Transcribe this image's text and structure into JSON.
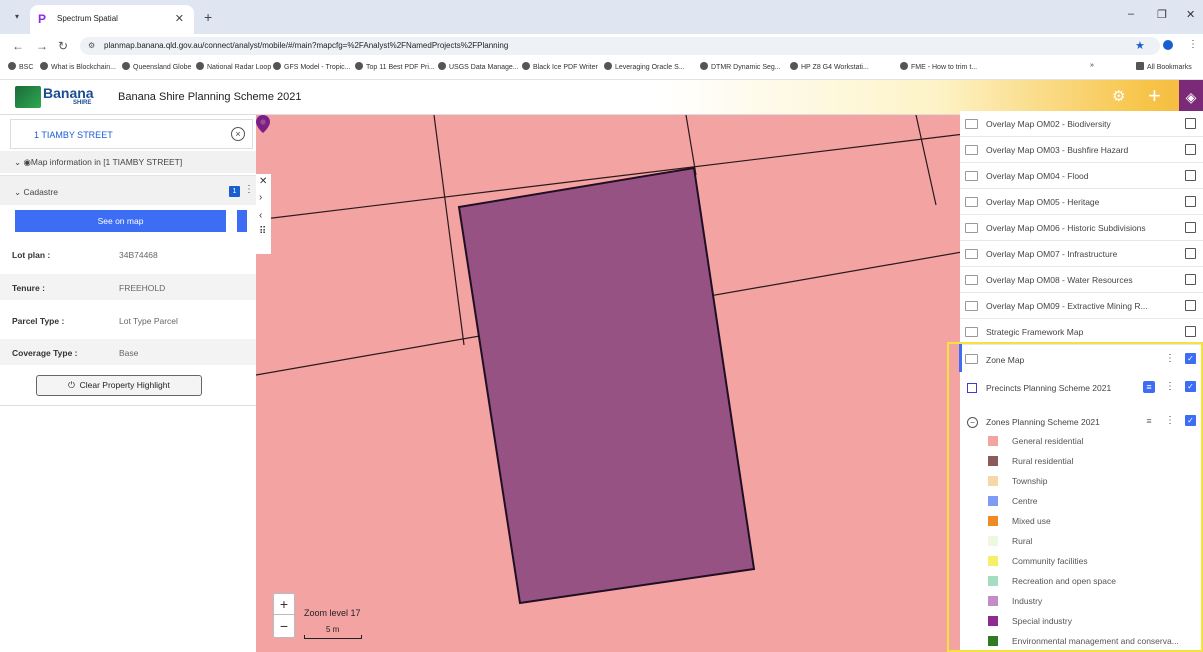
{
  "browser": {
    "tab_title": "Spectrum Spatial",
    "url": "planmap.banana.qld.gov.au/connect/analyst/mobile/#/main?mapcfg=%2FAnalyst%2FNamedProjects%2FPlanning",
    "bookmarks": [
      "BSC",
      "What is Blockchain...",
      "Queensland Globe",
      "National Radar Loop",
      "GFS Model - Tropic...",
      "Top 11 Best PDF Pri...",
      "USGS Data Manage...",
      "Black Ice PDF Writer",
      "Leveraging Oracle S...",
      "DTMR Dynamic Seg...",
      "HP Z8 G4 Workstati...",
      "FME - How to trim t...",
      "All Bookmarks"
    ]
  },
  "app": {
    "logo_text": "Banana",
    "logo_sub": "SHIRE",
    "title": "Banana Shire Planning Scheme 2021"
  },
  "left_panel": {
    "search_value": "1 TIAMBY STREET",
    "map_info_label": "Map information in [1 TIAMBY STREET]",
    "cadastre_label": "Cadastre",
    "cadastre_count": "1",
    "see_on_map": "See on map",
    "attributes": [
      {
        "key": "Lot plan :",
        "value": "34B74468"
      },
      {
        "key": "Tenure :",
        "value": "FREEHOLD"
      },
      {
        "key": "Parcel Type :",
        "value": "Lot Type Parcel"
      },
      {
        "key": "Coverage Type :",
        "value": "Base"
      }
    ],
    "clear_button": "Clear Property Highlight"
  },
  "map": {
    "zoom_level": "Zoom level 17",
    "scale": "5 m",
    "colors": {
      "zone": "#f4a3a3",
      "highlight": "#975284",
      "pin": "#7a1f8a"
    }
  },
  "layers": {
    "overlays": [
      "Overlay Map OM02 - Biodiversity",
      "Overlay Map OM03 - Bushfire Hazard",
      "Overlay Map OM04 - Flood",
      "Overlay Map OM05 - Heritage",
      "Overlay Map OM06 - Historic Subdivisions",
      "Overlay Map OM07 - Infrastructure",
      "Overlay Map OM08 - Water Resources",
      "Overlay Map OM09 - Extractive Mining R...",
      "Strategic Framework Map"
    ],
    "zone_map": "Zone Map",
    "precincts": "Precincts Planning Scheme 2021",
    "zones": "Zones Planning Scheme 2021",
    "legend": [
      {
        "label": "General residential",
        "color": "#f4a3a3"
      },
      {
        "label": "Rural residential",
        "color": "#8c5a5a"
      },
      {
        "label": "Township",
        "color": "#f5d7a8"
      },
      {
        "label": "Centre",
        "color": "#7f9cf5"
      },
      {
        "label": "Mixed use",
        "color": "#f08a24"
      },
      {
        "label": "Rural",
        "color": "#eef7df"
      },
      {
        "label": "Community facilities",
        "color": "#f5f067"
      },
      {
        "label": "Recreation and open space",
        "color": "#a6dcc0"
      },
      {
        "label": "Industry",
        "color": "#c48bc8"
      },
      {
        "label": "Special industry",
        "color": "#8e2a90"
      },
      {
        "label": "Environmental management and conserva...",
        "color": "#2f7a23"
      }
    ]
  }
}
